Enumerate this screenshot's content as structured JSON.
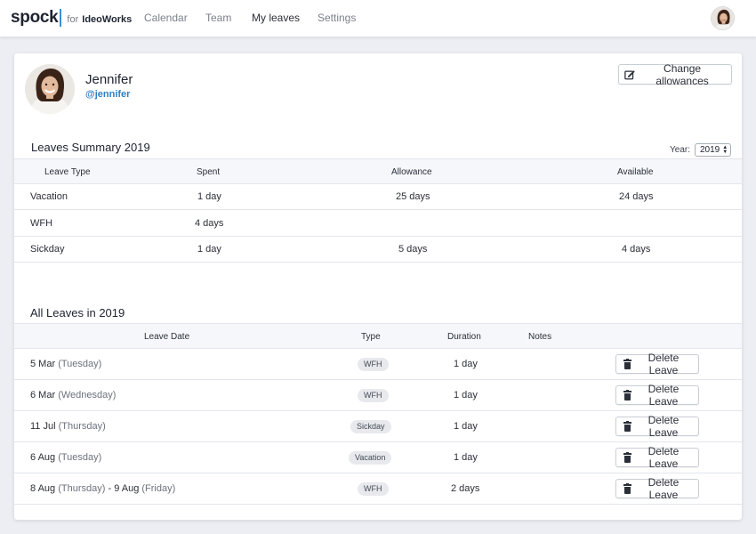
{
  "nav": {
    "brand": "spock",
    "brand_for": "for",
    "company": "IdeoWorks",
    "links": [
      "Calendar",
      "Team",
      "My leaves",
      "Settings"
    ],
    "active_link": "My leaves"
  },
  "profile": {
    "name": "Jennifer",
    "handle": "@jennifer",
    "change_allowances_label": "Change allowances"
  },
  "summary": {
    "title": "Leaves Summary 2019",
    "year_label": "Year:",
    "year_value": "2019",
    "headers": [
      "Leave Type",
      "Spent",
      "Allowance",
      "Available"
    ],
    "rows": [
      {
        "type": "Vacation",
        "spent": "1 day",
        "allowance": "25 days",
        "available": "24 days"
      },
      {
        "type": "WFH",
        "spent": "4 days",
        "allowance": "",
        "available": ""
      },
      {
        "type": "Sickday",
        "spent": "1 day",
        "allowance": "5 days",
        "available": "4 days"
      }
    ]
  },
  "leaves": {
    "title": "All Leaves in 2019",
    "headers": [
      "Leave Date",
      "Type",
      "Duration",
      "Notes"
    ],
    "delete_label": "Delete Leave",
    "rows": [
      {
        "date_a": "5 Mar",
        "day_a": "(Tuesday)",
        "sep": "",
        "date_b": "",
        "day_b": "",
        "type": "WFH",
        "duration": "1 day",
        "notes": ""
      },
      {
        "date_a": "6 Mar",
        "day_a": "(Wednesday)",
        "sep": "",
        "date_b": "",
        "day_b": "",
        "type": "WFH",
        "duration": "1 day",
        "notes": ""
      },
      {
        "date_a": "11 Jul",
        "day_a": "(Thursday)",
        "sep": "",
        "date_b": "",
        "day_b": "",
        "type": "Sickday",
        "duration": "1 day",
        "notes": ""
      },
      {
        "date_a": "6 Aug",
        "day_a": "(Tuesday)",
        "sep": "",
        "date_b": "",
        "day_b": "",
        "type": "Vacation",
        "duration": "1 day",
        "notes": ""
      },
      {
        "date_a": "8 Aug",
        "day_a": "(Thursday)",
        "sep": "-",
        "date_b": "9 Aug",
        "day_b": "(Friday)",
        "type": "WFH",
        "duration": "2 days",
        "notes": ""
      }
    ]
  },
  "colors": {
    "accent": "#2f7fc4",
    "page_bg": "#eceef3",
    "table_header_bg": "#f5f7fa",
    "badge_bg": "#e7e9ed"
  }
}
